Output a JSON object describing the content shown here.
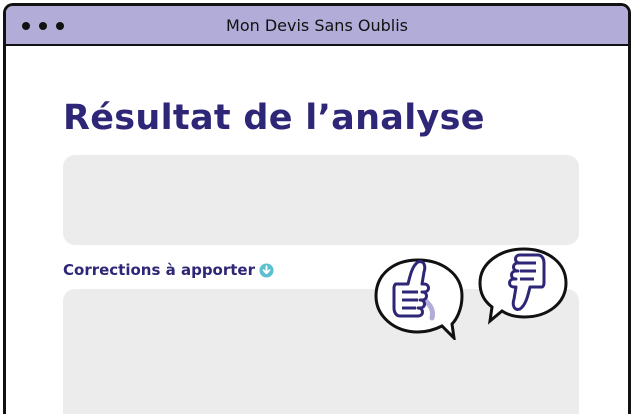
{
  "window": {
    "title": "Mon Devis Sans Oublis"
  },
  "main": {
    "heading": "Résultat de l’analyse",
    "corrections_label": "Corrections à apporter"
  },
  "icons": {
    "info": "arrow-down-circle-icon",
    "feedback_positive": "thumbs-up-icon",
    "feedback_negative": "thumbs-down-icon"
  },
  "colors": {
    "titlebar": "#b2acd8",
    "heading": "#2e2676",
    "info_icon": "#5bbfcf",
    "box": "#ececec",
    "outline": "#111111"
  }
}
